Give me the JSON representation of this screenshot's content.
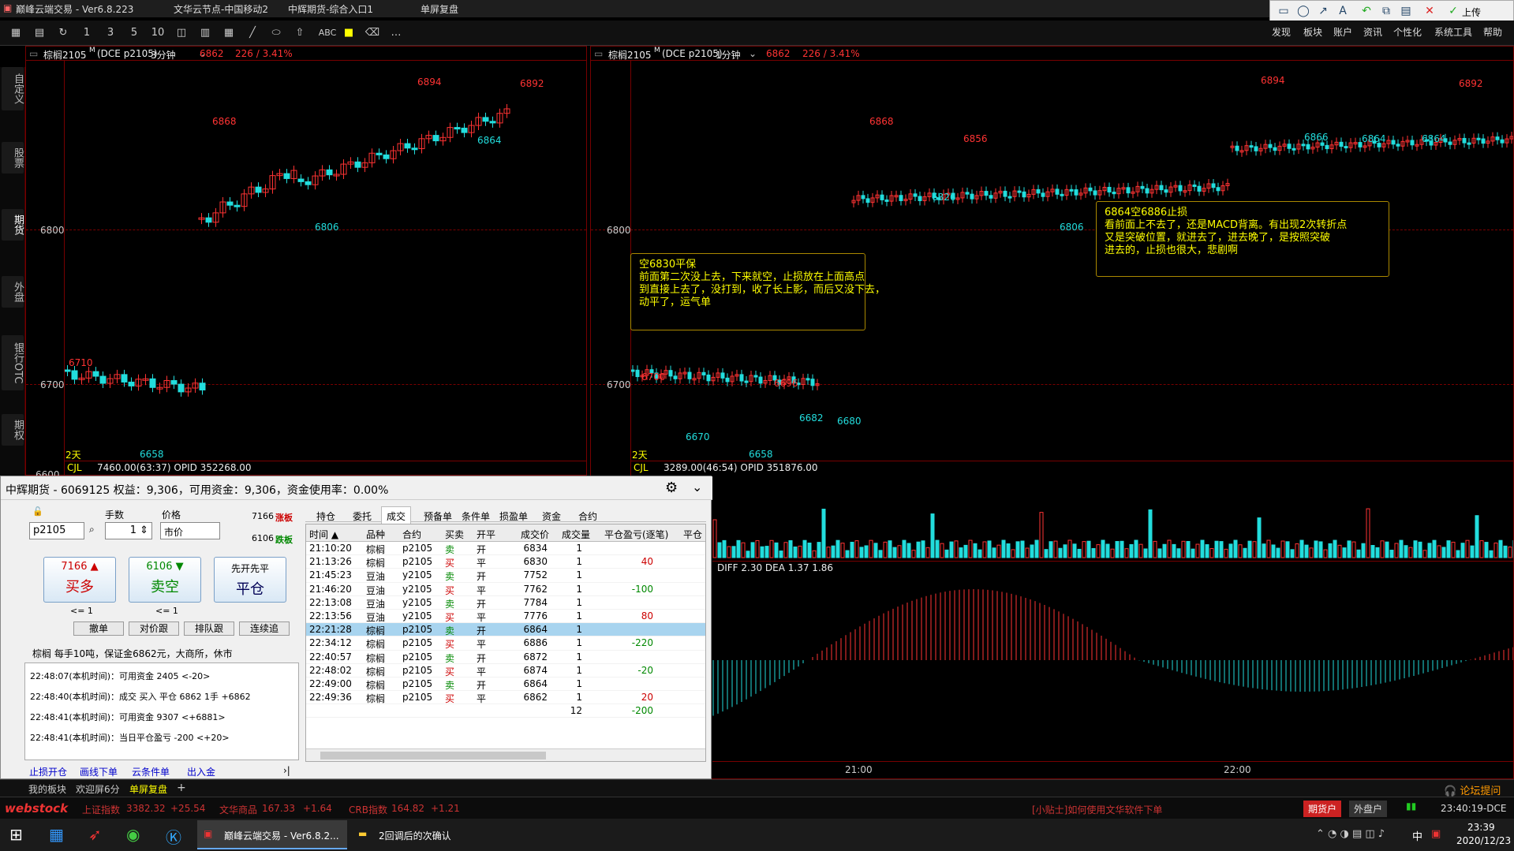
{
  "window": {
    "title": "巅峰云端交易 - Ver6.8.223",
    "node": "文华云节点-中国移动2",
    "entry": "中辉期货-综合入口1",
    "mode": "单屏复盘"
  },
  "top_tools": {
    "upload": "上传"
  },
  "toolbar": {
    "labels": [
      "1",
      "3",
      "5",
      "10",
      "ABC"
    ],
    "menus": [
      "发现",
      "板块",
      "账户",
      "资讯",
      "个性化",
      "系统工具",
      "帮助"
    ]
  },
  "side_tabs": [
    "自定义",
    "股票",
    "期货",
    "外盘",
    "银行OTC",
    "期权"
  ],
  "chart_left": {
    "symbol": "棕榈2105",
    "sup": "M",
    "exch": "(DCE p2105)",
    "period": "3分钟",
    "price": "6862",
    "change": "226 / 3.41%",
    "y_labels": [
      "6800",
      "6700",
      "6600"
    ],
    "price_labels": [
      {
        "t": "6894",
        "c": "red"
      },
      {
        "t": "6892",
        "c": "red"
      },
      {
        "t": "6868",
        "c": "red"
      },
      {
        "t": "6864",
        "c": "cyan"
      },
      {
        "t": "6806",
        "c": "cyan"
      },
      {
        "t": "6710",
        "c": "red"
      },
      {
        "t": "6658",
        "c": "cyan"
      }
    ],
    "days_label": "2天",
    "vol_label": "CJL",
    "vol_info": "7460.00(63:37)  OPID 352268.00"
  },
  "chart_right": {
    "symbol": "棕榈2105",
    "sup": "M",
    "exch": "(DCE p2105)",
    "period": "1分钟",
    "price": "6862",
    "change": "226 / 3.41%",
    "y_labels": [
      "6800",
      "6700"
    ],
    "price_labels": [
      {
        "t": "6894",
        "c": "red"
      },
      {
        "t": "6892",
        "c": "red"
      },
      {
        "t": "6868",
        "c": "red"
      },
      {
        "t": "6856",
        "c": "red"
      },
      {
        "t": "6826",
        "c": "cyan"
      },
      {
        "t": "6806",
        "c": "cyan"
      },
      {
        "t": "6866",
        "c": "cyan"
      },
      {
        "t": "6864",
        "c": "cyan"
      },
      {
        "t": "6864",
        "c": "cyan"
      },
      {
        "t": "6700",
        "c": "red"
      },
      {
        "t": "6696",
        "c": "red"
      },
      {
        "t": "6682",
        "c": "cyan"
      },
      {
        "t": "6680",
        "c": "cyan"
      },
      {
        "t": "6670",
        "c": "cyan"
      },
      {
        "t": "6658",
        "c": "cyan"
      }
    ],
    "days_label": "2天",
    "vol_label": "CJL",
    "vol_info": "3289.00(46:54)  OPID 351876.00",
    "macd_info": "DIFF 2.30  DEA 1.37   1.86",
    "time_labels": [
      "21:00",
      "22:00"
    ],
    "note1": "空6830平保\n前面第二次没上去，下来就空，止损放在上面高点\n到直接上去了，没打到，收了长上影，而后又没下去，\n动平了，运气单",
    "note2": "6864空6886止损\n看前面上不去了，还是MACD背离。有出现2次转折点\n又是突破位置，就进去了，进去晚了，是按照突破\n进去的，止损也很大，悲剧啊"
  },
  "trade": {
    "header": "中辉期货 - 6069125  权益：9,306，可用资金：9,306，资金使用率：0.00%",
    "qty_label": "手数",
    "price_label": "价格",
    "symbol": "p2105",
    "qty": "1",
    "price_type": "市价",
    "limit_up": "7166",
    "limit_up_tag": "涨板",
    "limit_down": "6106",
    "limit_down_tag": "跌板",
    "buy": {
      "price": "7166",
      "label": "买多",
      "sub": "<= 1"
    },
    "sell": {
      "price": "6106",
      "label": "卖空",
      "sub": "<= 1"
    },
    "close": {
      "top": "先开先平",
      "label": "平仓"
    },
    "small_buttons": [
      "撤单",
      "对价跟",
      "排队跟",
      "连续追"
    ],
    "info": "棕榈  每手10吨，保证金6862元，大商所，休市",
    "log": [
      "22:48:07(本机时间)：可用资金 2405  <-20>",
      "22:48:40(本机时间)：成交 买入 平仓 6862 1手 +6862",
      "22:48:41(本机时间)：可用资金 9307  <+6881>",
      "22:48:41(本机时间)：当日平仓盈亏 -200  <+20>"
    ],
    "links": [
      "止损开仓",
      "画线下单",
      "云条件单",
      "出入金"
    ],
    "tabs": [
      "持仓",
      "委托",
      "成交",
      "预备单",
      "条件单",
      "损盈单",
      "资金",
      "合约"
    ],
    "columns": [
      "时间 ▲",
      "品种",
      "合约",
      "买卖",
      "开平",
      "成交价",
      "成交量",
      "平仓盈亏(逐笔)",
      "平仓"
    ],
    "rows": [
      [
        "21:10:20",
        "棕榈",
        "p2105",
        "卖",
        "开",
        "6834",
        "1",
        ""
      ],
      [
        "21:13:26",
        "棕榈",
        "p2105",
        "买",
        "平",
        "6830",
        "1",
        "40"
      ],
      [
        "21:45:23",
        "豆油",
        "y2105",
        "卖",
        "开",
        "7752",
        "1",
        ""
      ],
      [
        "21:46:20",
        "豆油",
        "y2105",
        "买",
        "平",
        "7762",
        "1",
        "-100"
      ],
      [
        "22:13:08",
        "豆油",
        "y2105",
        "卖",
        "开",
        "7784",
        "1",
        ""
      ],
      [
        "22:13:56",
        "豆油",
        "y2105",
        "买",
        "平",
        "7776",
        "1",
        "80"
      ],
      [
        "22:21:28",
        "棕榈",
        "p2105",
        "卖",
        "开",
        "6864",
        "1",
        ""
      ],
      [
        "22:34:12",
        "棕榈",
        "p2105",
        "买",
        "平",
        "6886",
        "1",
        "-220"
      ],
      [
        "22:40:57",
        "棕榈",
        "p2105",
        "卖",
        "开",
        "6872",
        "1",
        ""
      ],
      [
        "22:48:02",
        "棕榈",
        "p2105",
        "买",
        "平",
        "6874",
        "1",
        "-20"
      ],
      [
        "22:49:00",
        "棕榈",
        "p2105",
        "卖",
        "开",
        "6864",
        "1",
        ""
      ],
      [
        "22:49:36",
        "棕榈",
        "p2105",
        "买",
        "平",
        "6862",
        "1",
        "20"
      ]
    ],
    "total": [
      "",
      "",
      "",
      "",
      "",
      "",
      "12",
      "-200"
    ]
  },
  "bottom_tabs": [
    "我的板块",
    "欢迎屏6分",
    "单屏复盘",
    "+"
  ],
  "forum": "论坛提问",
  "status": {
    "logo": "webstock",
    "items": [
      "上证指数",
      "3382.32",
      "+25.54",
      "文华商品",
      "167.33",
      "+1.64",
      "CRB指数",
      "164.82",
      "+1.21"
    ],
    "tip": "[小贴士]如何使用文华软件下单",
    "acct1": "期货户",
    "acct2": "外盘户",
    "time": "23:40:19-DCE"
  },
  "taskbar": {
    "app1": "巅峰云端交易 - Ver6.8.2...",
    "app2": "2回调后的次确认",
    "ime": "中",
    "clock": "23:39",
    "date": "2020/12/23"
  }
}
